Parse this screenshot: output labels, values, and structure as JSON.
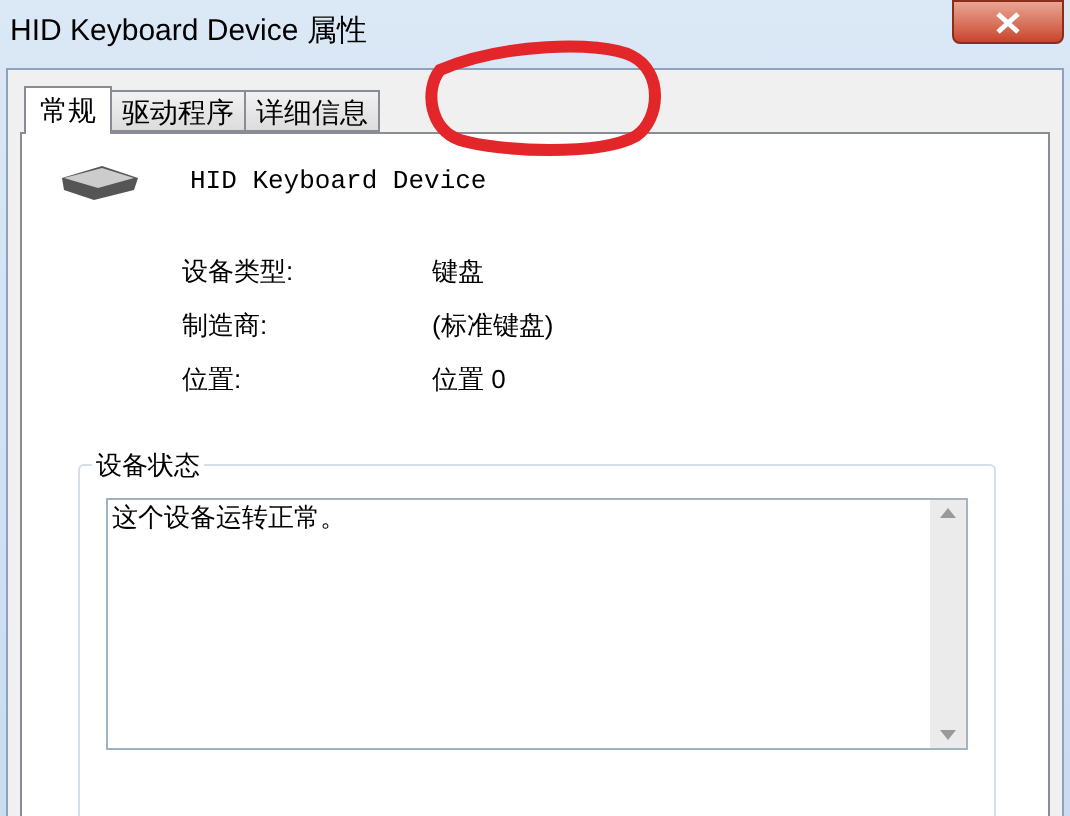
{
  "window": {
    "title": "HID Keyboard Device 属性"
  },
  "tabs": [
    {
      "label": "常规",
      "selected": true
    },
    {
      "label": "驱动程序",
      "selected": false
    },
    {
      "label": "详细信息",
      "selected": false
    }
  ],
  "device": {
    "name": "HID Keyboard Device"
  },
  "properties": [
    {
      "label": "设备类型:",
      "value": "键盘"
    },
    {
      "label": "制造商:",
      "value": "(标准键盘)"
    },
    {
      "label": "位置:",
      "value": "位置 0"
    }
  ],
  "device_status": {
    "title": "设备状态",
    "text": "这个设备运转正常。"
  }
}
